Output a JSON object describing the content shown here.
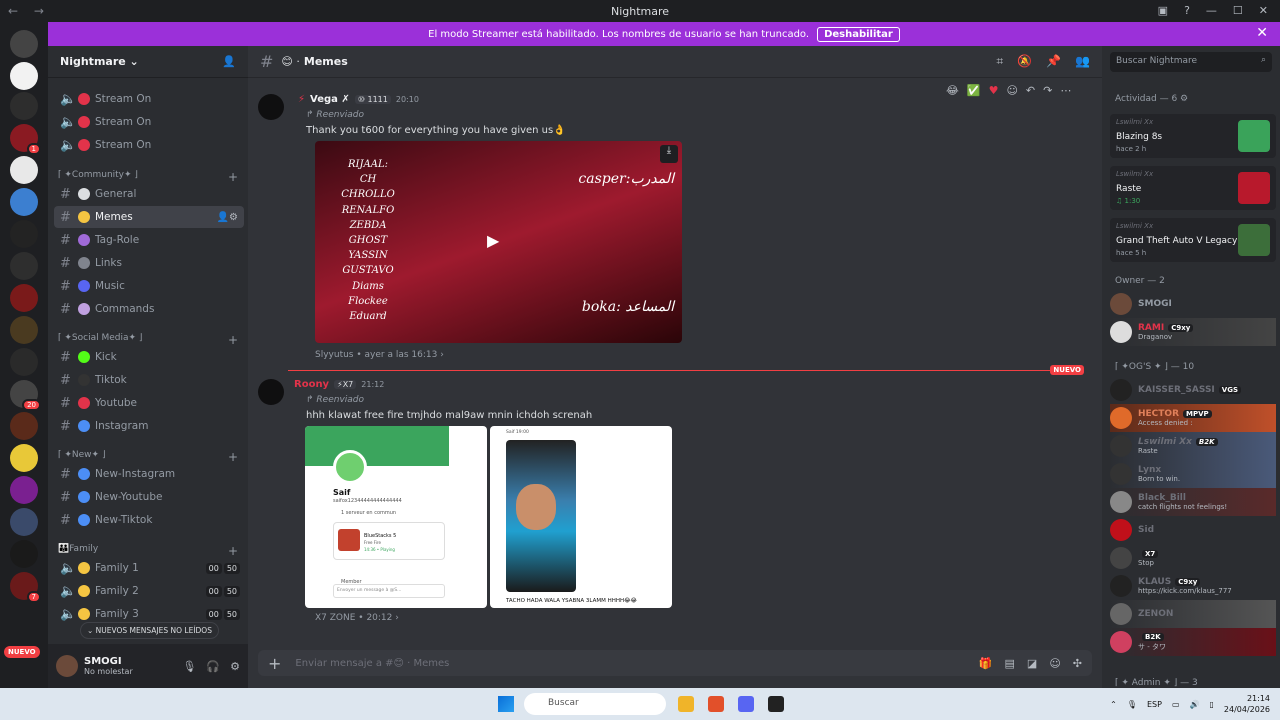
{
  "window": {
    "title": "Nightmare",
    "nav": "← →",
    "controls": [
      "▣",
      "?",
      "—",
      "☐",
      "✕"
    ]
  },
  "banner": {
    "text": "El modo Streamer está habilitado. Los nombres de usuario se han truncado.",
    "button": "Deshabilitar",
    "close": "✕"
  },
  "guild_rail": {
    "nuevo": "NUEVO",
    "badges": [
      "1",
      "20",
      "7"
    ]
  },
  "server": {
    "name": "Nightmare ⌄"
  },
  "channels": [
    {
      "label": "Stream On",
      "count": null
    },
    {
      "label": "Stream On",
      "count": null
    },
    {
      "label": "Stream On",
      "count": null
    },
    {
      "label": "General"
    },
    {
      "label": "Memes"
    },
    {
      "label": "Tag-Role"
    },
    {
      "label": "Links"
    },
    {
      "label": "Music"
    },
    {
      "label": "Commands"
    },
    {
      "label": "Kick"
    },
    {
      "label": "Tiktok"
    },
    {
      "label": "Youtube"
    },
    {
      "label": "Instagram"
    },
    {
      "label": "New-Instagram"
    },
    {
      "label": "New-Youtube"
    },
    {
      "label": "New-Tiktok"
    },
    {
      "label": "Family 1"
    },
    {
      "label": "Family 2"
    },
    {
      "label": "Family 3"
    }
  ],
  "categories": [
    "⌈ ✦Community✦ ⌋",
    "⌈ ✦Social Media✦ ⌋",
    "⌈ ✦New✦ ⌋",
    "👪Family"
  ],
  "voice_counts": [
    "00",
    "50"
  ],
  "unread_pill": "⌄ NUEVOS MENSAJES NO LEÍDOS",
  "user": {
    "name": "SMOGI",
    "status": "No molestar"
  },
  "channel_header": {
    "title": "Memes",
    "search": "Buscar Nightmare"
  },
  "messages": [
    {
      "author": "Vega ✗",
      "tag": "⑩ 1111",
      "time": "20:10",
      "forwarded": "Reenviado",
      "text": "Thank you t600  for everything you have given us👌",
      "video_names": [
        "RIJAAL:",
        "CH",
        "CHROLLO",
        "RENALFO",
        "ZEBDA",
        "GHOST",
        "YASSIN",
        "GUSTAVO",
        "Diams",
        "Flockee",
        "Eduard"
      ],
      "video_label1": "casper:المدرب",
      "video_label2": "boka: المساعد",
      "source": "Slyyutus • ayer a las 16:13 ›"
    },
    {
      "author": "Roony",
      "tag": "⚡X7",
      "time": "21:12",
      "forwarded": "Reenviado",
      "text": "hhh klawat free fire tmjhdo mal9aw mnin ichdoh screnah",
      "profile_name": "Saif",
      "profile_sub": "saifox12344444444444444",
      "profile_srv": "1 serveur en commun",
      "game_title": "BlueStacks 5",
      "game_sub": "Free Fire",
      "game_time": "14:36 • Playing",
      "member": "Member",
      "input_ph": "Envoyer un message à @S...",
      "img2_header": "Saif 19:00",
      "caption": "TACHO HADA WALA YSABNA 3LAMM HHHH😂😂",
      "source": "X7 ZONE • 20:12 ›"
    }
  ],
  "new_label": "NUEVO",
  "composer": {
    "placeholder": "Enviar mensaje a #😊 · Memes"
  },
  "activity": {
    "header": "Actividad — 6 ⚙",
    "items": [
      {
        "user": "Lswilmi Xx",
        "game": "Blazing 8s",
        "meta": "hace 2 h",
        "color": "#3aa35a"
      },
      {
        "user": "Lswilmi Xx",
        "game": "Raste",
        "meta": "♫ 1:30",
        "color": "#b8192c"
      },
      {
        "user": "Lswilmi Xx",
        "game": "Grand Theft Auto V Legacy",
        "meta": "hace 5 h",
        "color": "#3c6e3a"
      }
    ]
  },
  "members": {
    "owner_header": "Owner — 2",
    "ogs_header": "⌈ ✦OG'S ✦ ⌋ — 10",
    "admin_header": "⌈ ✦ Admin ✦ ⌋ — 3",
    "owners": [
      {
        "name": "SMOGI",
        "badge": "",
        "status": ""
      },
      {
        "name": "RAMI",
        "badge": "C9xy",
        "status": "Draganov"
      }
    ],
    "ogs": [
      {
        "name": "KAISSER_SASSI",
        "badge": "VGS",
        "status": ""
      },
      {
        "name": "HECTOR",
        "badge": "MPVP",
        "status": "Access denied :"
      },
      {
        "name": "Lswilmi Xx",
        "badge": "B2K",
        "status": "Raste"
      },
      {
        "name": "Lynx",
        "badge": "",
        "status": "Born to win."
      },
      {
        "name": "Black_Bill",
        "badge": "",
        "status": "catch flights not feelings!"
      },
      {
        "name": "Sid",
        "badge": "",
        "status": ""
      },
      {
        "name": "",
        "badge": "X7",
        "status": "Stop"
      },
      {
        "name": "KLAUS",
        "badge": "C9xy",
        "status": "https://kick.com/klaus_777"
      },
      {
        "name": "ZENON",
        "badge": "",
        "status": ""
      },
      {
        "name": "",
        "badge": "B2K",
        "status": "サ - タワ"
      }
    ]
  },
  "taskbar": {
    "search": "Buscar",
    "lang": "ESP",
    "time": "21:14",
    "date": "24/04/2026"
  }
}
